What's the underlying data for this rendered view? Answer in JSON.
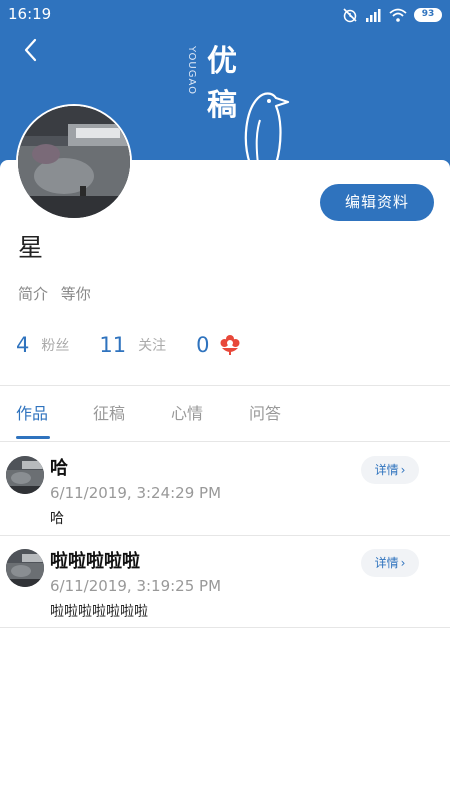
{
  "status_bar": {
    "time": "16:19",
    "battery": "93"
  },
  "brand": {
    "english": "YOUGAO",
    "chinese_1": "优",
    "chinese_2": "稿"
  },
  "profile": {
    "nickname": "星",
    "bio_label": "简介",
    "bio_text": "等你",
    "edit_label": "编辑资料",
    "stats": {
      "fans_count": "4",
      "fans_label": "粉丝",
      "following_count": "11",
      "following_label": "关注",
      "flowers_count": "0"
    }
  },
  "tabs": [
    {
      "label": "作品",
      "active": true
    },
    {
      "label": "征稿",
      "active": false
    },
    {
      "label": "心情",
      "active": false
    },
    {
      "label": "问答",
      "active": false
    }
  ],
  "posts": [
    {
      "title": "哈",
      "time": "6/11/2019, 3:24:29 PM",
      "body": "哈",
      "detail_label": "详情"
    },
    {
      "title": "啦啦啦啦啦",
      "time": "6/11/2019, 3:19:25 PM",
      "body": "啦啦啦啦啦啦啦",
      "detail_label": "详情"
    }
  ],
  "colors": {
    "primary": "#2f73be",
    "flower": "#e8483a"
  },
  "icons": {
    "back": "chevron-left-icon",
    "alarm_off": "alarm-off-icon",
    "signal": "signal-icon",
    "wifi": "wifi-icon",
    "battery": "battery-icon",
    "flower": "flower-icon"
  }
}
